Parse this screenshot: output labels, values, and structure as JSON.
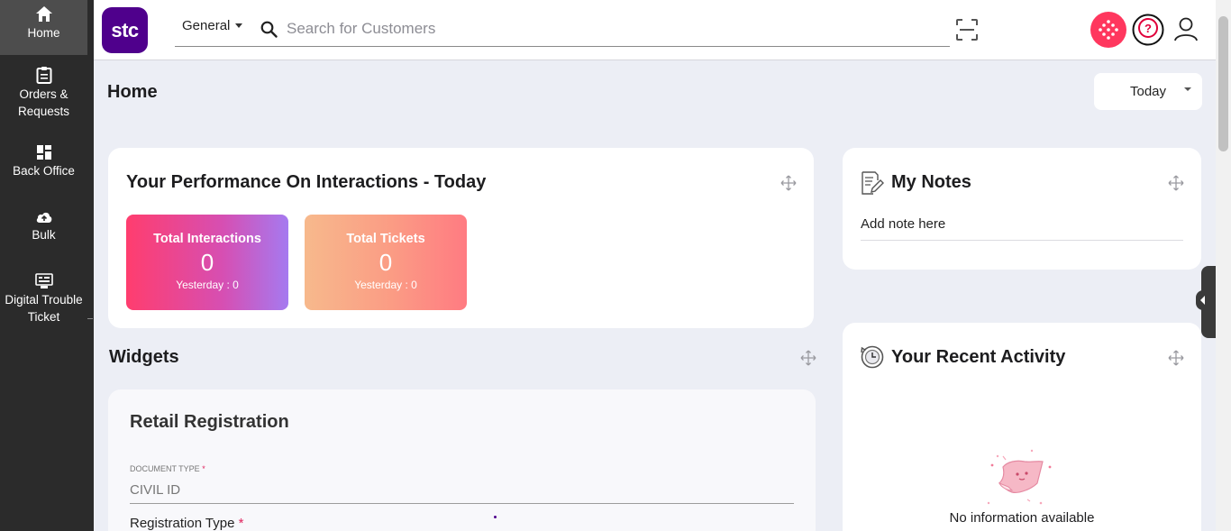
{
  "sidebar": {
    "items": [
      {
        "label": "Home",
        "icon": "home-icon"
      },
      {
        "label": "Orders & Requests",
        "icon": "clipboard-icon"
      },
      {
        "label": "Back Office",
        "icon": "dashboard-icon"
      },
      {
        "label": "Bulk",
        "icon": "cloud-upload-icon"
      },
      {
        "label": "Digital Trouble Ticket",
        "icon": "ticket-icon"
      }
    ]
  },
  "header": {
    "logo_text": "stc",
    "scope_label": "General",
    "search_placeholder": "Search for Customers",
    "brand_color": "#4f008c",
    "accent_color": "#ff375e"
  },
  "page": {
    "title": "Home",
    "period": "Today"
  },
  "performance": {
    "title": "Your Performance On Interactions - Today",
    "stats": [
      {
        "label": "Total Interactions",
        "value": "0",
        "sub": "Yesterday : 0"
      },
      {
        "label": "Total Tickets",
        "value": "0",
        "sub": "Yesterday : 0"
      }
    ]
  },
  "notes": {
    "title": "My Notes",
    "placeholder": "Add note here"
  },
  "widgets": {
    "title": "Widgets"
  },
  "retail": {
    "title": "Retail Registration",
    "document_type_label": "DOCUMENT TYPE",
    "document_type_value": "CIVIL ID",
    "registration_type_label": "Registration Type"
  },
  "activity": {
    "title": "Your Recent Activity",
    "empty_text": "No information available"
  }
}
